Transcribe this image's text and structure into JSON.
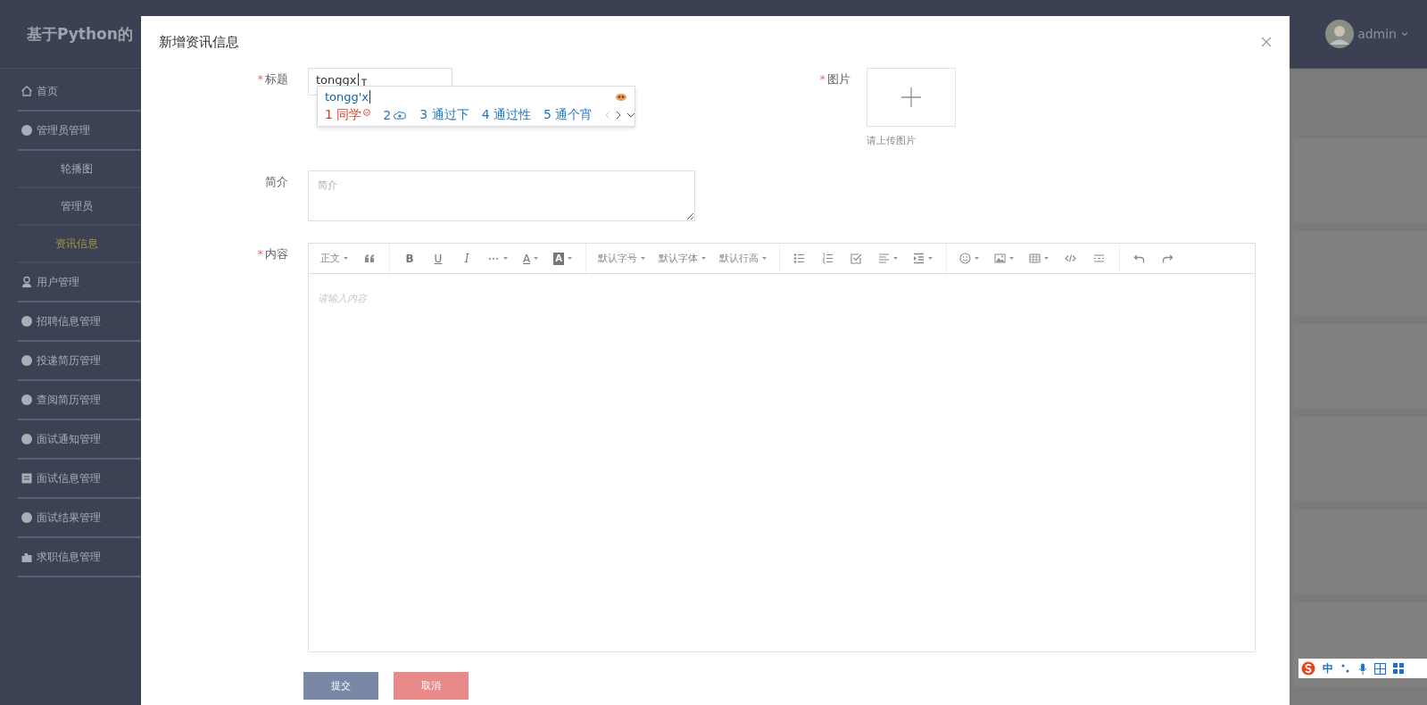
{
  "app": {
    "title": "基于Python的",
    "user": {
      "name": "admin"
    }
  },
  "sidebar": {
    "items": [
      {
        "label": "首页",
        "kind": "home",
        "selected": false
      },
      {
        "label": "管理员管理",
        "kind": "dot",
        "selected": false,
        "children": [
          {
            "label": "轮播图",
            "selected": false
          },
          {
            "label": "管理员",
            "selected": false
          },
          {
            "label": "资讯信息",
            "selected": true
          }
        ]
      },
      {
        "label": "用户管理",
        "kind": "user",
        "selected": false
      },
      {
        "label": "招聘信息管理",
        "kind": "dot",
        "selected": false
      },
      {
        "label": "投递简历管理",
        "kind": "dot",
        "selected": false
      },
      {
        "label": "查阅简历管理",
        "kind": "dot",
        "selected": false
      },
      {
        "label": "面试通知管理",
        "kind": "dot",
        "selected": false
      },
      {
        "label": "面试信息管理",
        "kind": "doc",
        "selected": false
      },
      {
        "label": "面试结果管理",
        "kind": "dot",
        "selected": false
      },
      {
        "label": "求职信息管理",
        "kind": "chart",
        "selected": false
      }
    ]
  },
  "dialog": {
    "title": "新增资讯信息",
    "title_field": {
      "label": "标题",
      "required_mark": "*",
      "value": "tonggx"
    },
    "ime": {
      "composition": "tongg'x",
      "candidates": [
        {
          "num": "1",
          "kind": "text",
          "text": "同学",
          "selected": true,
          "verified": true
        },
        {
          "num": "2",
          "kind": "emoji",
          "selected": false,
          "verified": false
        },
        {
          "num": "3",
          "kind": "text",
          "text": "通过下",
          "selected": false,
          "verified": false
        },
        {
          "num": "4",
          "kind": "text",
          "text": "通过性",
          "selected": false,
          "verified": false
        },
        {
          "num": "5",
          "kind": "text",
          "text": "通个宵",
          "selected": false,
          "verified": false
        }
      ]
    },
    "image_field": {
      "label": "图片",
      "required_mark": "*",
      "hint": "请上传图片"
    },
    "intro_field": {
      "label": "简介",
      "placeholder": "简介"
    },
    "content_field": {
      "label": "内容",
      "required_mark": "*",
      "placeholder": "请输入内容",
      "toolbar": [
        [
          {
            "kind": "text",
            "label": "正文",
            "dropdown": true
          },
          {
            "kind": "quote",
            "dropdown": false
          }
        ],
        [
          {
            "kind": "bold",
            "label": "B",
            "dropdown": false
          },
          {
            "kind": "underline",
            "label": "U",
            "dropdown": false
          },
          {
            "kind": "italic",
            "label": "I",
            "dropdown": false
          },
          {
            "kind": "more",
            "dropdown": true
          },
          {
            "kind": "font-color",
            "label": "A",
            "dropdown": true
          },
          {
            "kind": "back-color",
            "label": "A",
            "dropdown": true
          }
        ],
        [
          {
            "kind": "text",
            "label": "默认字号",
            "dropdown": true
          },
          {
            "kind": "text",
            "label": "默认字体",
            "dropdown": true
          },
          {
            "kind": "text",
            "label": "默认行高",
            "dropdown": true
          }
        ],
        [
          {
            "kind": "bullets",
            "dropdown": false
          },
          {
            "kind": "numbers",
            "dropdown": false
          },
          {
            "kind": "todo",
            "dropdown": false
          },
          {
            "kind": "align",
            "dropdown": true
          },
          {
            "kind": "indent",
            "dropdown": true
          }
        ],
        [
          {
            "kind": "emoji",
            "dropdown": true
          },
          {
            "kind": "image",
            "dropdown": true
          },
          {
            "kind": "table",
            "dropdown": true
          },
          {
            "kind": "code",
            "dropdown": false
          },
          {
            "kind": "divider",
            "dropdown": false
          }
        ],
        [
          {
            "kind": "undo",
            "dropdown": false
          },
          {
            "kind": "redo",
            "dropdown": false
          }
        ]
      ]
    },
    "buttons": [
      {
        "label": "提交",
        "kind": "primary"
      },
      {
        "label": "取消",
        "kind": "danger"
      }
    ]
  },
  "ime_bar": {
    "mode": "中"
  }
}
